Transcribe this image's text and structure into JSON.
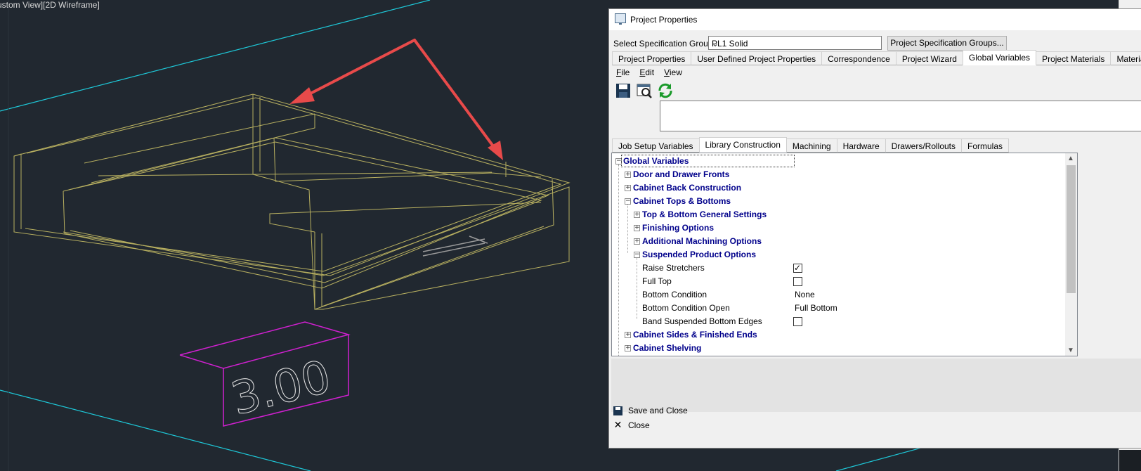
{
  "viewport": {
    "label": "ustom View][2D Wireframe]",
    "dimension_text": "3.00"
  },
  "dialog": {
    "title": "Project Properties",
    "spec_group_label": "Select Specification Group",
    "spec_group_value": "PL1 Solid",
    "spec_groups_button": "Project Specification Groups...",
    "tabs": [
      "Project Properties",
      "User Defined Project Properties",
      "Correspondence",
      "Project Wizard",
      "Global Variables",
      "Project Materials",
      "Material Wizards"
    ],
    "active_tab": "Global Variables",
    "menu": [
      "File",
      "Edit",
      "View"
    ],
    "toolbar_icons": [
      "save-icon",
      "preview-icon",
      "refresh-icon"
    ],
    "sub_tabs": [
      "Job Setup Variables",
      "Library Construction",
      "Machining",
      "Hardware",
      "Drawers/Rollouts",
      "Formulas"
    ],
    "active_sub_tab": "Library Construction",
    "tree": {
      "root": "Global Variables",
      "door_fronts": "Door and Drawer Fronts",
      "back_construction": "Cabinet Back Construction",
      "tops_bottoms": "Cabinet Tops & Bottoms",
      "general_settings": "Top & Bottom General Settings",
      "finishing": "Finishing Options",
      "machining": "Additional Machining Options",
      "suspended": "Suspended Product Options",
      "raise_stretchers": {
        "label": "Raise Stretchers",
        "checked": true
      },
      "full_top": {
        "label": "Full Top",
        "checked": false
      },
      "bottom_condition": {
        "label": "Bottom Condition",
        "value": "None"
      },
      "bottom_condition_open": {
        "label": "Bottom Condition Open",
        "value": "Full Bottom"
      },
      "band_edges": {
        "label": "Band Suspended Bottom Edges",
        "checked": false
      },
      "sides": "Cabinet Sides & Finished Ends",
      "shelving": "Cabinet Shelving"
    },
    "save_and_close": "Save and Close",
    "close": "Close"
  },
  "colors": {
    "background": "#212830",
    "wireframe": "#b8b060",
    "cyan_line": "#1ec8d8",
    "magenta_box": "#d020d0",
    "arrow": "#e84a4a",
    "tree_group": "#00008b"
  }
}
